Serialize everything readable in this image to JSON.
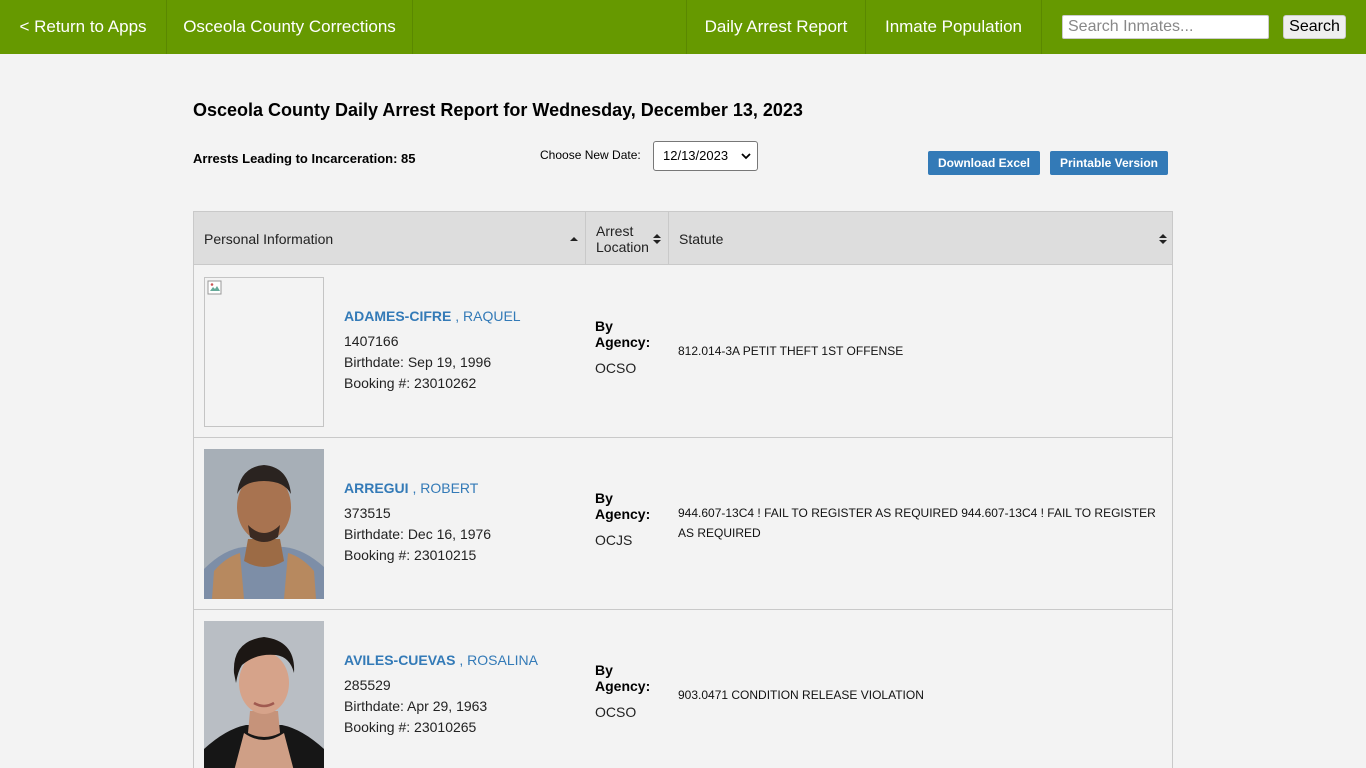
{
  "nav": {
    "return_label": "< Return to Apps",
    "site_name": "Osceola County Corrections",
    "daily_arrest": "Daily Arrest Report",
    "inmate_population": "Inmate Population",
    "search_placeholder": "Search Inmates...",
    "search_button": "Search"
  },
  "report": {
    "title": "Osceola County Daily Arrest Report for Wednesday, December 13, 2023",
    "arrests_count": "Arrests Leading to Incarceration: 85",
    "date_label": "Choose New Date:",
    "date_value": "12/13/2023",
    "download_excel": "Download Excel",
    "printable_version": "Printable Version"
  },
  "table": {
    "headers": {
      "personal": "Personal Information",
      "arrest_location_1": "Arrest",
      "arrest_location_2": "Location",
      "statute": "Statute"
    },
    "rows": [
      {
        "last_name": "ADAMES-CIFRE",
        "first_name": ", RAQUEL",
        "id": "1407166",
        "birthdate": "Birthdate: Sep 19, 1996",
        "booking": "Booking #: 23010262",
        "by_agency": "By Agency:",
        "agency": "OCSO",
        "statute": "812.014-3A PETIT THEFT 1ST OFFENSE",
        "photo": "broken-image-icon"
      },
      {
        "last_name": "ARREGUI",
        "first_name": ", ROBERT",
        "id": "373515",
        "birthdate": "Birthdate: Dec 16, 1976",
        "booking": "Booking #: 23010215",
        "by_agency": "By Agency:",
        "agency": "OCJS",
        "statute": "944.607-13C4 ! FAIL TO REGISTER AS REQUIRED 944.607-13C4 ! FAIL TO REGISTER AS REQUIRED",
        "photo": "mugshot"
      },
      {
        "last_name": "AVILES-CUEVAS",
        "first_name": ", ROSALINA",
        "id": "285529",
        "birthdate": "Birthdate: Apr 29, 1963",
        "booking": "Booking #: 23010265",
        "by_agency": "By Agency:",
        "agency": "OCSO",
        "statute": "903.0471 CONDITION RELEASE VIOLATION",
        "photo": "mugshot"
      }
    ]
  },
  "colors": {
    "nav_green": "#669900",
    "link_blue": "#337ab7",
    "button_blue": "#337ab7"
  }
}
